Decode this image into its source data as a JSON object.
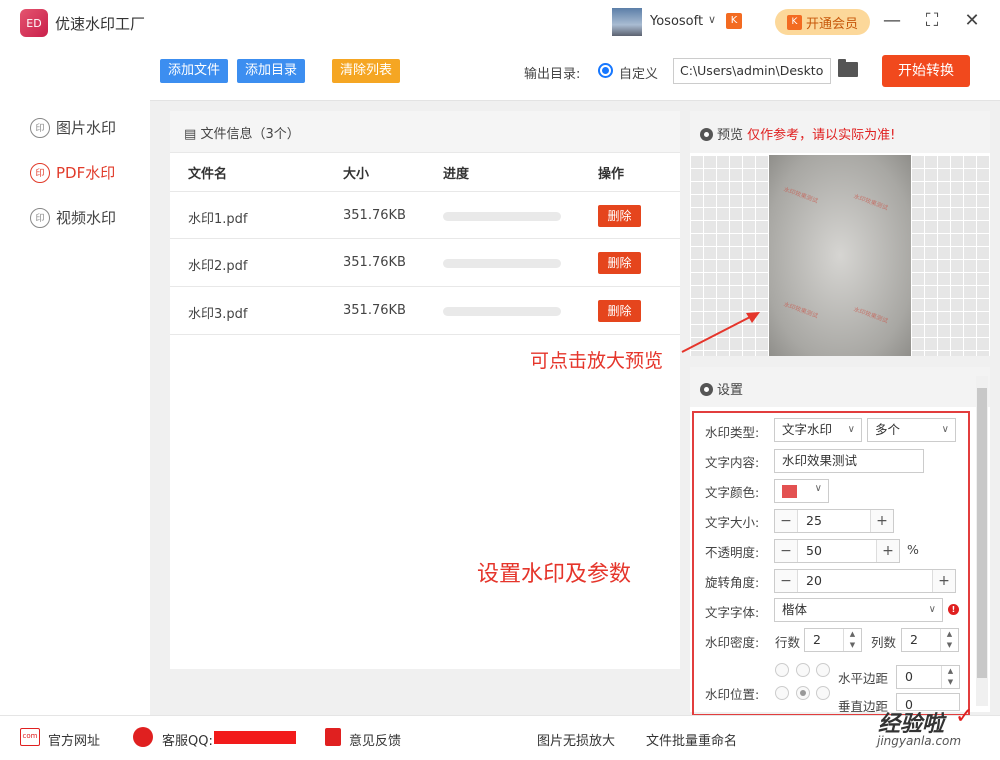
{
  "app": {
    "logo": "ED",
    "title": "优速水印工厂",
    "username": "Yososoft",
    "vip_label": "开通会员",
    "vip_icon": "K"
  },
  "window": {
    "minimize": "—",
    "maximize": "⛶",
    "close": "✕"
  },
  "sidebar": {
    "items": [
      {
        "label": "图片水印",
        "icon": "印"
      },
      {
        "label": "PDF水印",
        "icon": "印"
      },
      {
        "label": "视频水印",
        "icon": "印"
      }
    ]
  },
  "toolbar": {
    "add_file": "添加文件",
    "add_dir": "添加目录",
    "clear": "清除列表",
    "output_label": "输出目录:",
    "custom_label": "自定义",
    "output_path": "C:\\Users\\admin\\Deskto",
    "start": "开始转换"
  },
  "files": {
    "title": "文件信息（3个）",
    "columns": [
      "文件名",
      "大小",
      "进度",
      "操作"
    ],
    "rows": [
      {
        "name": "水印1.pdf",
        "size": "351.76KB",
        "progress": 0,
        "action": "删除"
      },
      {
        "name": "水印2.pdf",
        "size": "351.76KB",
        "progress": 0,
        "action": "删除"
      },
      {
        "name": "水印3.pdf",
        "size": "351.76KB",
        "progress": 0,
        "action": "删除"
      }
    ]
  },
  "preview": {
    "title": "预览",
    "warning": "仅作参考，请以实际为准!"
  },
  "annotations": {
    "click_zoom": "可点击放大预览",
    "set_params": "设置水印及参数"
  },
  "settings": {
    "title": "设置",
    "type_label": "水印类型:",
    "type_value": "文字水印",
    "count_value": "多个",
    "content_label": "文字内容:",
    "content_value": "水印效果测试",
    "color_label": "文字颜色:",
    "color_value": "#e35151",
    "size_label": "文字大小:",
    "size_value": "25",
    "opacity_label": "不透明度:",
    "opacity_value": "50",
    "opacity_unit": "%",
    "rotate_label": "旋转角度:",
    "rotate_value": "20",
    "font_label": "文字字体:",
    "font_value": "楷体",
    "density_label": "水印密度:",
    "rows_label": "行数",
    "rows_value": "2",
    "cols_label": "列数",
    "cols_value": "2",
    "position_label": "水印位置:",
    "hmargin_label": "水平边距",
    "hmargin_value": "0",
    "vmargin_label": "垂直边距",
    "vmargin_value": "0"
  },
  "footer": {
    "website": "官方网址",
    "qq": "客服QQ:",
    "feedback": "意见反馈",
    "link1": "图片无损放大",
    "link2": "文件批量重命名"
  },
  "watermark_badge": {
    "text": "经验啦",
    "sub": "jingyanla.com",
    "check": "✓"
  },
  "colors": {
    "accent": "#1677ff",
    "danger": "#e5451d",
    "start": "#f1491d",
    "annotation": "#e5352b"
  }
}
